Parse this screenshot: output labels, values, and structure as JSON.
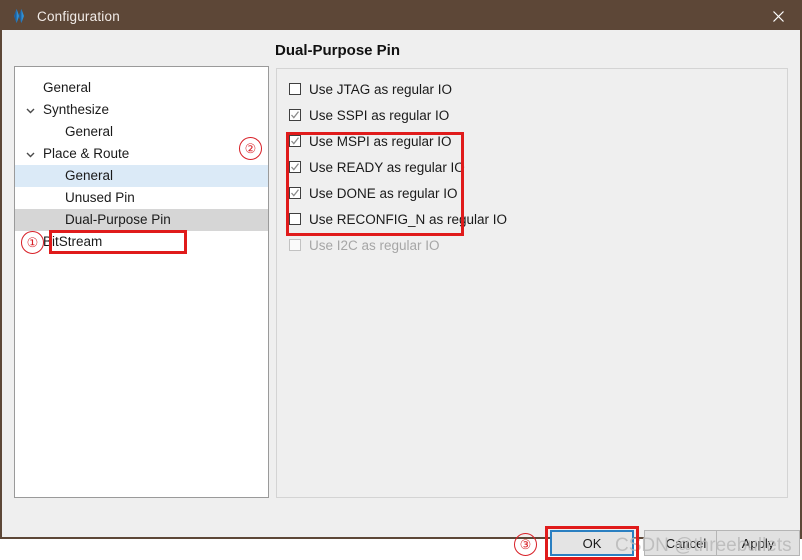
{
  "window": {
    "title": "Configuration",
    "icon": "gowin-diamond-icon",
    "close_label": "×",
    "titlebar_color": "#5d4737"
  },
  "tree": {
    "items": [
      {
        "label": "General",
        "indent": 28,
        "twisty": "",
        "state": "normal"
      },
      {
        "label": "Synthesize",
        "indent": 28,
        "twisty": "down",
        "state": "normal"
      },
      {
        "label": "General",
        "indent": 50,
        "twisty": "",
        "state": "normal"
      },
      {
        "label": "Place & Route",
        "indent": 28,
        "twisty": "down",
        "state": "normal"
      },
      {
        "label": "General",
        "indent": 50,
        "twisty": "",
        "state": "highlight"
      },
      {
        "label": "Unused Pin",
        "indent": 50,
        "twisty": "",
        "state": "normal"
      },
      {
        "label": "Dual-Purpose Pin",
        "indent": 50,
        "twisty": "",
        "state": "selected"
      },
      {
        "label": "BitStream",
        "indent": 28,
        "twisty": "",
        "state": "normal"
      }
    ]
  },
  "pane": {
    "title": "Dual-Purpose Pin",
    "checkboxes": [
      {
        "label": "Use JTAG as regular IO",
        "checked": false,
        "enabled": true
      },
      {
        "label": "Use SSPI as regular IO",
        "checked": true,
        "enabled": true
      },
      {
        "label": "Use MSPI as regular IO",
        "checked": true,
        "enabled": true
      },
      {
        "label": "Use READY as regular IO",
        "checked": true,
        "enabled": true
      },
      {
        "label": "Use DONE as regular IO",
        "checked": true,
        "enabled": true
      },
      {
        "label": "Use RECONFIG_N as regular IO",
        "checked": false,
        "enabled": true
      },
      {
        "label": "Use I2C as regular IO",
        "checked": false,
        "enabled": false
      }
    ]
  },
  "buttons": {
    "ok": "OK",
    "cancel": "Cancel",
    "apply": "Apply"
  },
  "annotations": {
    "color": "#e01b1b",
    "markers": [
      {
        "id": "1",
        "label": "①"
      },
      {
        "id": "2",
        "label": "②"
      },
      {
        "id": "3",
        "label": "③"
      }
    ]
  },
  "watermark": {
    "text": "CSDN @threebullets"
  }
}
